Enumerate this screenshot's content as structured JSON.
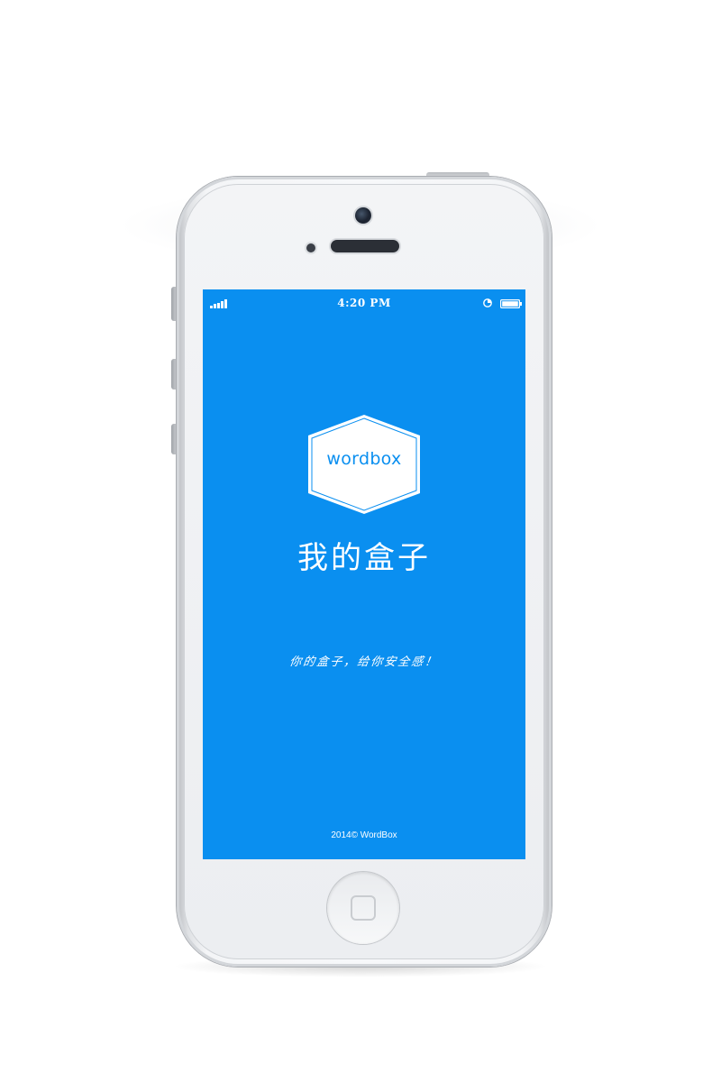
{
  "status_bar": {
    "time": "4:20 PM",
    "signal_icon": "signal-bars-icon",
    "alarm_icon": "alarm-clock-icon",
    "battery_icon": "battery-icon"
  },
  "splash": {
    "logo_text": "wordbox",
    "title": "我的盒子",
    "tagline": "你的盒子，给你安全感！",
    "copyright": "2014© WordBox"
  },
  "colors": {
    "screen_background": "#0a8ff0",
    "text": "#ffffff",
    "logo_fill": "#ffffff"
  }
}
